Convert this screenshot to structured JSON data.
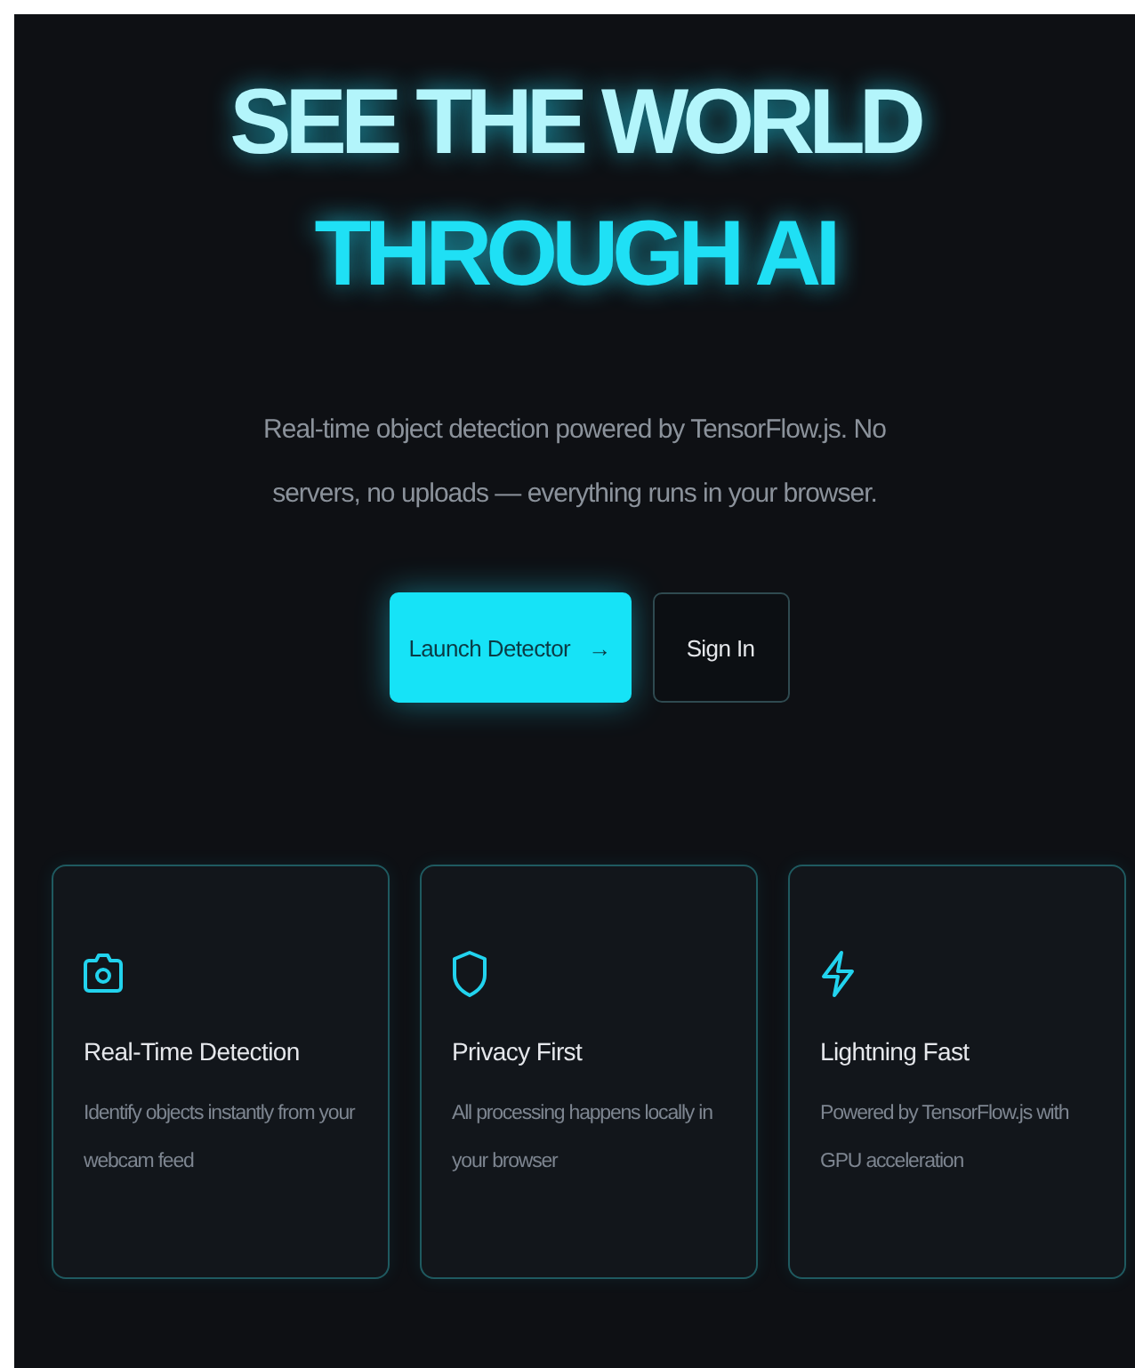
{
  "hero": {
    "title_line_1": "SEE THE WORLD",
    "title_line_2": "THROUGH AI",
    "subtitle": "Real-time object detection powered by TensorFlow.js. No servers, no uploads — everything runs in your browser."
  },
  "buttons": [
    {
      "kind": "primary",
      "label": "Launch Detector",
      "icon": "→"
    },
    {
      "kind": "secondary",
      "label": "Sign In"
    }
  ],
  "features": [
    {
      "title": "Real-Time Detection",
      "description": "Identify objects instantly from your webcam feed"
    },
    {
      "title": "Privacy First",
      "description": "All processing happens locally in your browser"
    },
    {
      "title": "Lightning Fast",
      "description": "Powered by TensorFlow.js with GPU acceleration"
    }
  ]
}
